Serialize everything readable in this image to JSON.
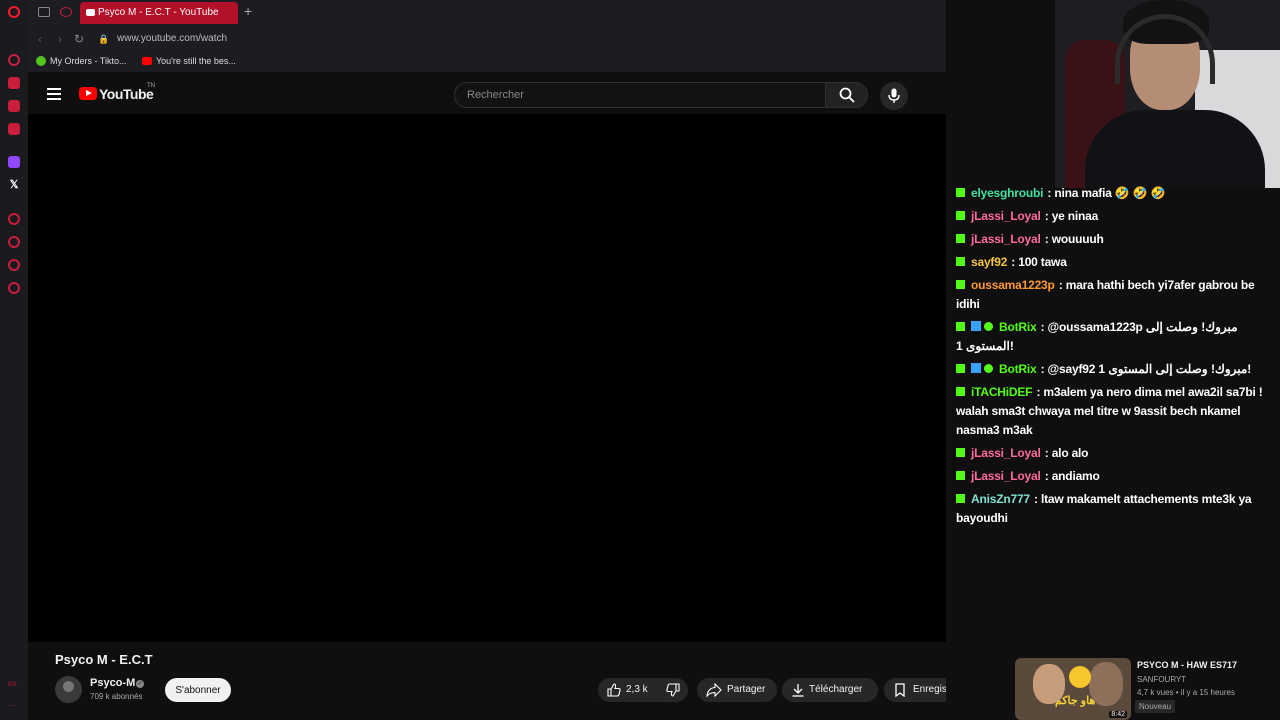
{
  "browser": {
    "tab_title": "Psyco M - E.C.T - YouTube",
    "new_tab": "+",
    "url": "www.youtube.com/watch",
    "bookmarks": [
      {
        "label": "My Orders - Tikto..."
      },
      {
        "label": "You're still the bes..."
      }
    ]
  },
  "youtube": {
    "logo_text": "YouTube",
    "logo_tn": "TN",
    "search_placeholder": "Rechercher"
  },
  "video": {
    "title": "Psyco M - E.C.T",
    "channel": "Psyco-M",
    "subscribers": "709 k abonnés",
    "subscribe_label": "S'abonner",
    "likes": "2,3 k",
    "share_label": "Partager",
    "download_label": "Télécharger",
    "save_label": "Enregistrer"
  },
  "recommended": {
    "title": "PSYCO M - HAW ES717",
    "channel": "SANFOURYT",
    "meta": "4,7 k vues • il y a 15 heures",
    "badge": "Nouveau",
    "duration": "8:42",
    "thumb_text": "هاو جاكم"
  },
  "chat": {
    "messages": [
      {
        "user": "elyesghroubi",
        "color": "#45e0a0",
        "text": ": nina mafia 🤣 🤣 🤣",
        "badges": [
          "kick"
        ]
      },
      {
        "user": "jLassi_Loyal",
        "color": "#ff6b9a",
        "text": ": ye ninaa",
        "badges": [
          "kick"
        ]
      },
      {
        "user": "jLassi_Loyal",
        "color": "#ff6b9a",
        "text": ": wouuuuh",
        "badges": [
          "kick"
        ]
      },
      {
        "user": "sayf92",
        "color": "#f5c542",
        "text": ": 100 tawa",
        "badges": [
          "kick"
        ]
      },
      {
        "user": "oussama1223p",
        "color": "#ff9933",
        "text": ": mara hathi bech yi7afer gabrou be idihi",
        "badges": [
          "kick"
        ]
      },
      {
        "user": "BotRix",
        "color": "#53fc18",
        "text": ": @oussama1223p مبروك! وصلت إلى المستوى 1!",
        "badges": [
          "kick",
          "blue",
          "green"
        ]
      },
      {
        "user": "BotRix",
        "color": "#53fc18",
        "text": ": @sayf92 مبروك! وصلت إلى المستوى 1!",
        "badges": [
          "kick",
          "blue",
          "green"
        ]
      },
      {
        "user": "iTACHiDEF",
        "color": "#53fc18",
        "text": ": m3alem ya nero dima mel awa2il sa7bi ! walah sma3t chwaya mel titre w 9assit bech nkamel nasma3 m3ak",
        "badges": [
          "kick"
        ]
      },
      {
        "user": "jLassi_Loyal",
        "color": "#ff6b9a",
        "text": ": alo alo",
        "badges": [
          "kick"
        ]
      },
      {
        "user": "jLassi_Loyal",
        "color": "#ff6b9a",
        "text": ": andiamo",
        "badges": [
          "kick"
        ]
      },
      {
        "user": "AnisZn777",
        "color": "#7fe0d0",
        "text": ": ltaw makamelt attachements mte3k ya bayoudhi",
        "badges": [
          "kick"
        ]
      }
    ]
  }
}
